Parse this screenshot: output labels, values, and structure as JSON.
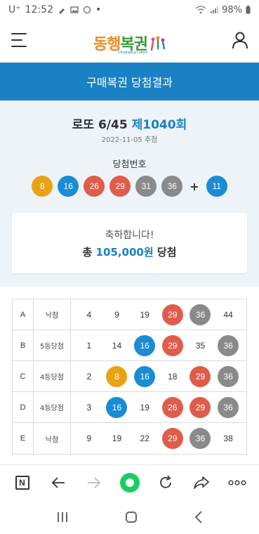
{
  "status_bar": {
    "carrier": "U⁺",
    "time": "12:52",
    "notif_dot": "•",
    "battery": "98%"
  },
  "header": {
    "logo_part1": "동행",
    "logo_part2": "복권",
    "logo_sub": "Donghaeng Lottery"
  },
  "banner": {
    "title": "구매복권 당첨결과"
  },
  "draw": {
    "game": "로또 6/45",
    "round": "제1040회",
    "date": "2022-11-05 추첨",
    "win_label": "당첨번호",
    "numbers": [
      {
        "n": "8",
        "color": "#e8a315"
      },
      {
        "n": "16",
        "color": "#1a8bd4"
      },
      {
        "n": "26",
        "color": "#e05c4a"
      },
      {
        "n": "29",
        "color": "#e05c4a"
      },
      {
        "n": "31",
        "color": "#8a8a8a"
      },
      {
        "n": "36",
        "color": "#8a8a8a"
      }
    ],
    "plus": "+",
    "bonus": {
      "n": "11",
      "color": "#1a8bd4"
    }
  },
  "result": {
    "congrats": "축하합니다!",
    "prize_prefix": "총 ",
    "prize_amount": "105,000원",
    "prize_suffix": " 당첨"
  },
  "tickets": [
    {
      "letter": "A",
      "rank": "낙첨",
      "nums": [
        {
          "n": "4",
          "color": null
        },
        {
          "n": "9",
          "color": null
        },
        {
          "n": "19",
          "color": null
        },
        {
          "n": "29",
          "color": "#e05c4a"
        },
        {
          "n": "36",
          "color": "#8a8a8a"
        },
        {
          "n": "44",
          "color": null
        }
      ]
    },
    {
      "letter": "B",
      "rank": "5등당첨",
      "nums": [
        {
          "n": "1",
          "color": null
        },
        {
          "n": "14",
          "color": null
        },
        {
          "n": "16",
          "color": "#1a8bd4"
        },
        {
          "n": "29",
          "color": "#e05c4a"
        },
        {
          "n": "35",
          "color": null
        },
        {
          "n": "36",
          "color": "#8a8a8a"
        }
      ]
    },
    {
      "letter": "C",
      "rank": "4등당첨",
      "nums": [
        {
          "n": "2",
          "color": null
        },
        {
          "n": "8",
          "color": "#e8a315"
        },
        {
          "n": "16",
          "color": "#1a8bd4"
        },
        {
          "n": "18",
          "color": null
        },
        {
          "n": "29",
          "color": "#e05c4a"
        },
        {
          "n": "36",
          "color": "#8a8a8a"
        }
      ]
    },
    {
      "letter": "D",
      "rank": "4등당첨",
      "nums": [
        {
          "n": "3",
          "color": null
        },
        {
          "n": "16",
          "color": "#1a8bd4"
        },
        {
          "n": "19",
          "color": null
        },
        {
          "n": "26",
          "color": "#e05c4a"
        },
        {
          "n": "29",
          "color": "#e05c4a"
        },
        {
          "n": "36",
          "color": "#8a8a8a"
        }
      ]
    },
    {
      "letter": "E",
      "rank": "낙첨",
      "nums": [
        {
          "n": "9",
          "color": null
        },
        {
          "n": "19",
          "color": null
        },
        {
          "n": "22",
          "color": null
        },
        {
          "n": "29",
          "color": "#e05c4a"
        },
        {
          "n": "36",
          "color": "#8a8a8a"
        },
        {
          "n": "38",
          "color": null
        }
      ]
    }
  ],
  "browser_bar": {
    "home_label": "N",
    "icons": [
      "naver-home-icon",
      "back-arrow-icon",
      "forward-arrow-icon",
      "green-dot-icon",
      "refresh-icon",
      "share-icon",
      "more-icon"
    ]
  },
  "colors": {
    "brand_blue": "#1a81c4",
    "bg_light": "#eef3f8"
  }
}
